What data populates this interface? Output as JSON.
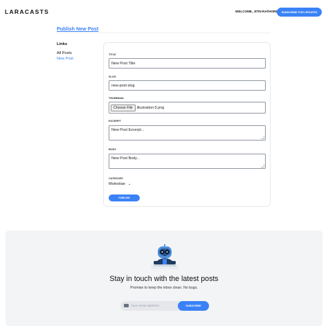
{
  "header": {
    "logo": "LARACASTS",
    "welcome": "WELCOME, JITIN RATHORE!",
    "subscribe_button": "SUBSCRIBE FOR UPDATES"
  },
  "page": {
    "title": "Publish New Post"
  },
  "sidebar": {
    "heading": "Links",
    "items": [
      {
        "label": "All Posts",
        "active": false
      },
      {
        "label": "New Post",
        "active": true
      }
    ]
  },
  "form": {
    "title": {
      "label": "TITLE",
      "value": "New Post Title"
    },
    "slug": {
      "label": "SLUG",
      "value": "new-post-slug"
    },
    "thumbnail": {
      "label": "THUMBNAIL",
      "button": "Choose File",
      "filename": "illustration-5.png"
    },
    "excerpt": {
      "label": "EXCERPT",
      "value": "New Post Excerpt..."
    },
    "body": {
      "label": "BODY",
      "value": "New Post Body..."
    },
    "category": {
      "label": "CATEGORY",
      "selected": "Molestiae"
    },
    "submit": "PUBLISH"
  },
  "newsletter": {
    "heading": "Stay in touch with the latest posts",
    "subheading": "Promise to keep the inbox clean. No bugs.",
    "email_placeholder": "Your email address",
    "subscribe_button": "SUBSCRIBE",
    "icons": [
      "mascot-illustration",
      "mail-icon"
    ]
  },
  "colors": {
    "accent": "#3b82f6",
    "footer_bg": "#f3f4f6"
  }
}
